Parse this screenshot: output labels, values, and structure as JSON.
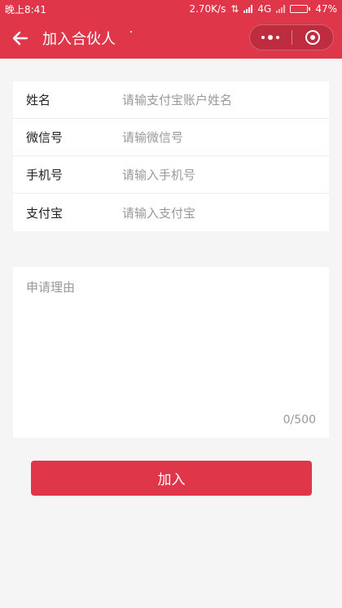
{
  "status_bar": {
    "time": "晚上8:41",
    "network_speed": "2.70K/s",
    "network_type": "4G",
    "battery": "47%",
    "battery_level": 0.47
  },
  "header": {
    "title": "加入合伙人",
    "back_icon": "arrow-left-icon",
    "menu_icon": "more-dots-icon",
    "close_icon": "target-circle-icon"
  },
  "form": {
    "fields": [
      {
        "label": "姓名",
        "placeholder": "请输支付宝账户姓名"
      },
      {
        "label": "微信号",
        "placeholder": "请输微信号"
      },
      {
        "label": "手机号",
        "placeholder": "请输入手机号"
      },
      {
        "label": "支付宝",
        "placeholder": "请输入支付宝"
      }
    ]
  },
  "reason": {
    "placeholder": "申请理由",
    "counter": "0/500"
  },
  "submit": {
    "label": "加入"
  },
  "colors": {
    "accent": "#e0364a",
    "background": "#f5f5f5"
  }
}
